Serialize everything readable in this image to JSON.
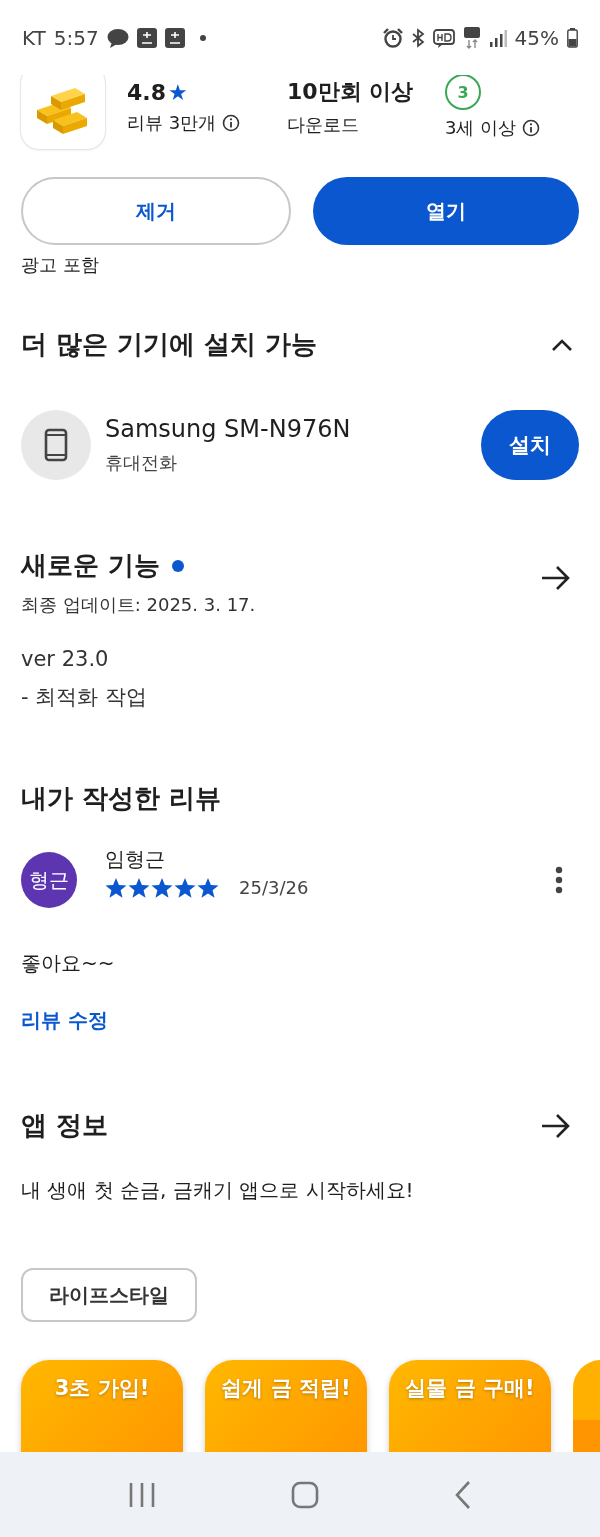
{
  "status_bar": {
    "carrier": "KT",
    "time": "5:57",
    "battery": "45%"
  },
  "app": {
    "rating": "4.8",
    "rating_star": "★",
    "reviews": "리뷰 3만개",
    "downloads": "10만회 이상",
    "downloads_label": "다운로드",
    "age_badge": "3",
    "age": "3세 이상"
  },
  "buttons": [
    {
      "label": "제거",
      "kind": "outline"
    },
    {
      "label": "열기",
      "kind": "filled"
    }
  ],
  "ad_notice": "광고 포함",
  "devices_section": {
    "title": "더 많은 기기에 설치 가능",
    "expanded": true,
    "devices": [
      {
        "name": "Samsung SM-N976N",
        "type": "휴대전화",
        "button": "설치"
      }
    ]
  },
  "whats_new": {
    "title": "새로운 기능",
    "new_dot": true,
    "updated": "최종 업데이트: 2025. 3. 17.",
    "notes": [
      "ver 23.0",
      "- 최적화 작업"
    ]
  },
  "my_review": {
    "title": "내가 작성한 리뷰",
    "avatar": "형근",
    "author": "임형근",
    "stars": 5,
    "date": "25/3/26",
    "text": "좋아요~~",
    "edit_link": "리뷰 수정"
  },
  "app_info": {
    "title": "앱 정보",
    "description": "내 생애 첫 순금, 금캐기 앱으로 시작하세요!",
    "tags": [
      "라이프스타일"
    ]
  },
  "screenshots": [
    {
      "kind": "promo",
      "title": "3초 가입!"
    },
    {
      "kind": "promo",
      "title": "쉽게 금 적립!"
    },
    {
      "kind": "promo",
      "title": "실물 금 구매!"
    },
    {
      "kind": "picture"
    }
  ]
}
